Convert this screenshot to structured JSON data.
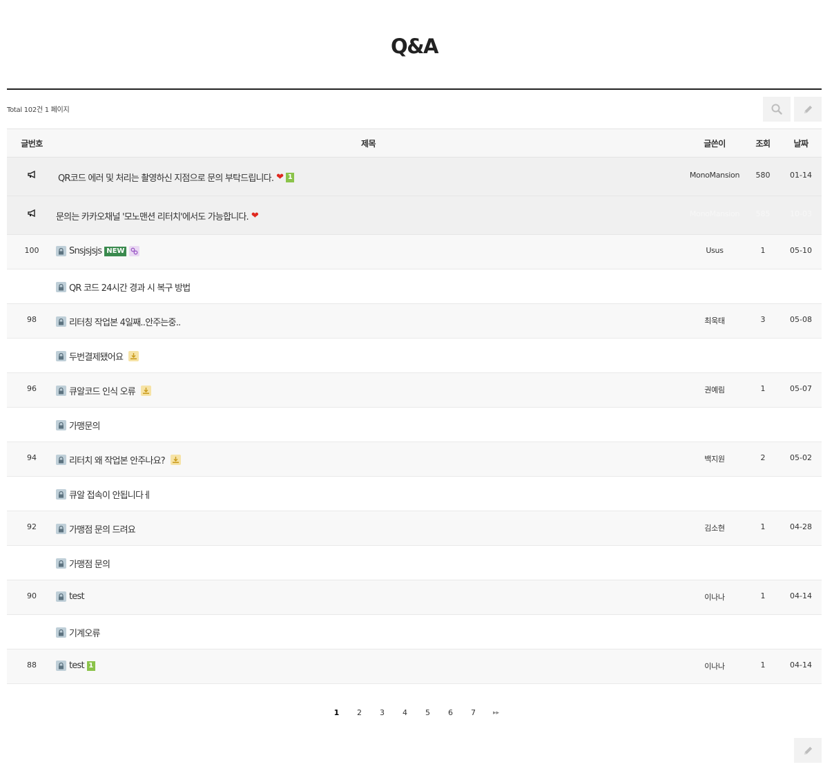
{
  "page_title": "Q&A",
  "total_text": "Total 102건 1 페이지",
  "columns": {
    "num": "글번호",
    "subject": "제목",
    "writer": "글쓴이",
    "hits": "조회",
    "date": "날짜"
  },
  "notices": [
    {
      "subject": "QR코드 에러 및 처리는 촬영하신 지점으로 문의 부탁드립니다.",
      "heart": "❤",
      "comment_count": "1",
      "writer": "MonoMansion",
      "hits": "580",
      "date": "01-14"
    },
    {
      "subject": "문의는 카카오채널 '모노맨션 리터치'에서도 가능합니다.",
      "heart": "❤",
      "writer": "MonoMansion",
      "hits": "585",
      "date": "10-03"
    }
  ],
  "posts": [
    {
      "num": "100",
      "subject": "Snsjsjsjs",
      "new_label": "NEW",
      "writer": "Usus",
      "hits": "1",
      "date": "05-10"
    },
    {
      "num": "",
      "subject": "QR 코드 24시간 경과 시 복구 방법",
      "writer": "",
      "hits": "",
      "date": ""
    },
    {
      "num": "98",
      "subject": "리터칭 작업본 4일째..안주는중..",
      "writer": "최욱태",
      "hits": "3",
      "date": "05-08"
    },
    {
      "num": "",
      "subject": "두번결제됐어요",
      "writer": "",
      "hits": "",
      "date": ""
    },
    {
      "num": "96",
      "subject": "큐알코드 인식 오류",
      "writer": "권예림",
      "hits": "1",
      "date": "05-07"
    },
    {
      "num": "",
      "subject": "가맹문의",
      "writer": "",
      "hits": "",
      "date": ""
    },
    {
      "num": "94",
      "subject": "리터치 왜 작업본 안주나요?",
      "writer": "백지원",
      "hits": "2",
      "date": "05-02"
    },
    {
      "num": "",
      "subject": "큐알 접속이 안됩니다ㅔ",
      "writer": "",
      "hits": "",
      "date": ""
    },
    {
      "num": "92",
      "subject": "가맹점 문의 드려요",
      "writer": "김소현",
      "hits": "1",
      "date": "04-28"
    },
    {
      "num": "",
      "subject": "가맹점 문의",
      "writer": "",
      "hits": "",
      "date": ""
    },
    {
      "num": "90",
      "subject": "test",
      "writer": "이나나",
      "hits": "1",
      "date": "04-14"
    },
    {
      "num": "",
      "subject": "기계오류",
      "writer": "",
      "hits": "",
      "date": ""
    },
    {
      "num": "88",
      "subject": "test",
      "comment_count": "1",
      "writer": "이나나",
      "hits": "1",
      "date": "04-14"
    }
  ],
  "pagination": {
    "pages": [
      "1",
      "2",
      "3",
      "4",
      "5",
      "6",
      "7"
    ],
    "current": "1",
    "last_label": "▸▸"
  },
  "icons": {
    "search": "search-icon",
    "write": "pencil-icon",
    "notice": "megaphone-icon",
    "lock": "lock-icon",
    "link": "link-icon",
    "file": "download-icon"
  },
  "colors": {
    "new_badge": "#3a8a4e",
    "comment_badge": "#8bc34a",
    "heart": "#e0281f",
    "lock_bg": "#bfcfd8"
  }
}
